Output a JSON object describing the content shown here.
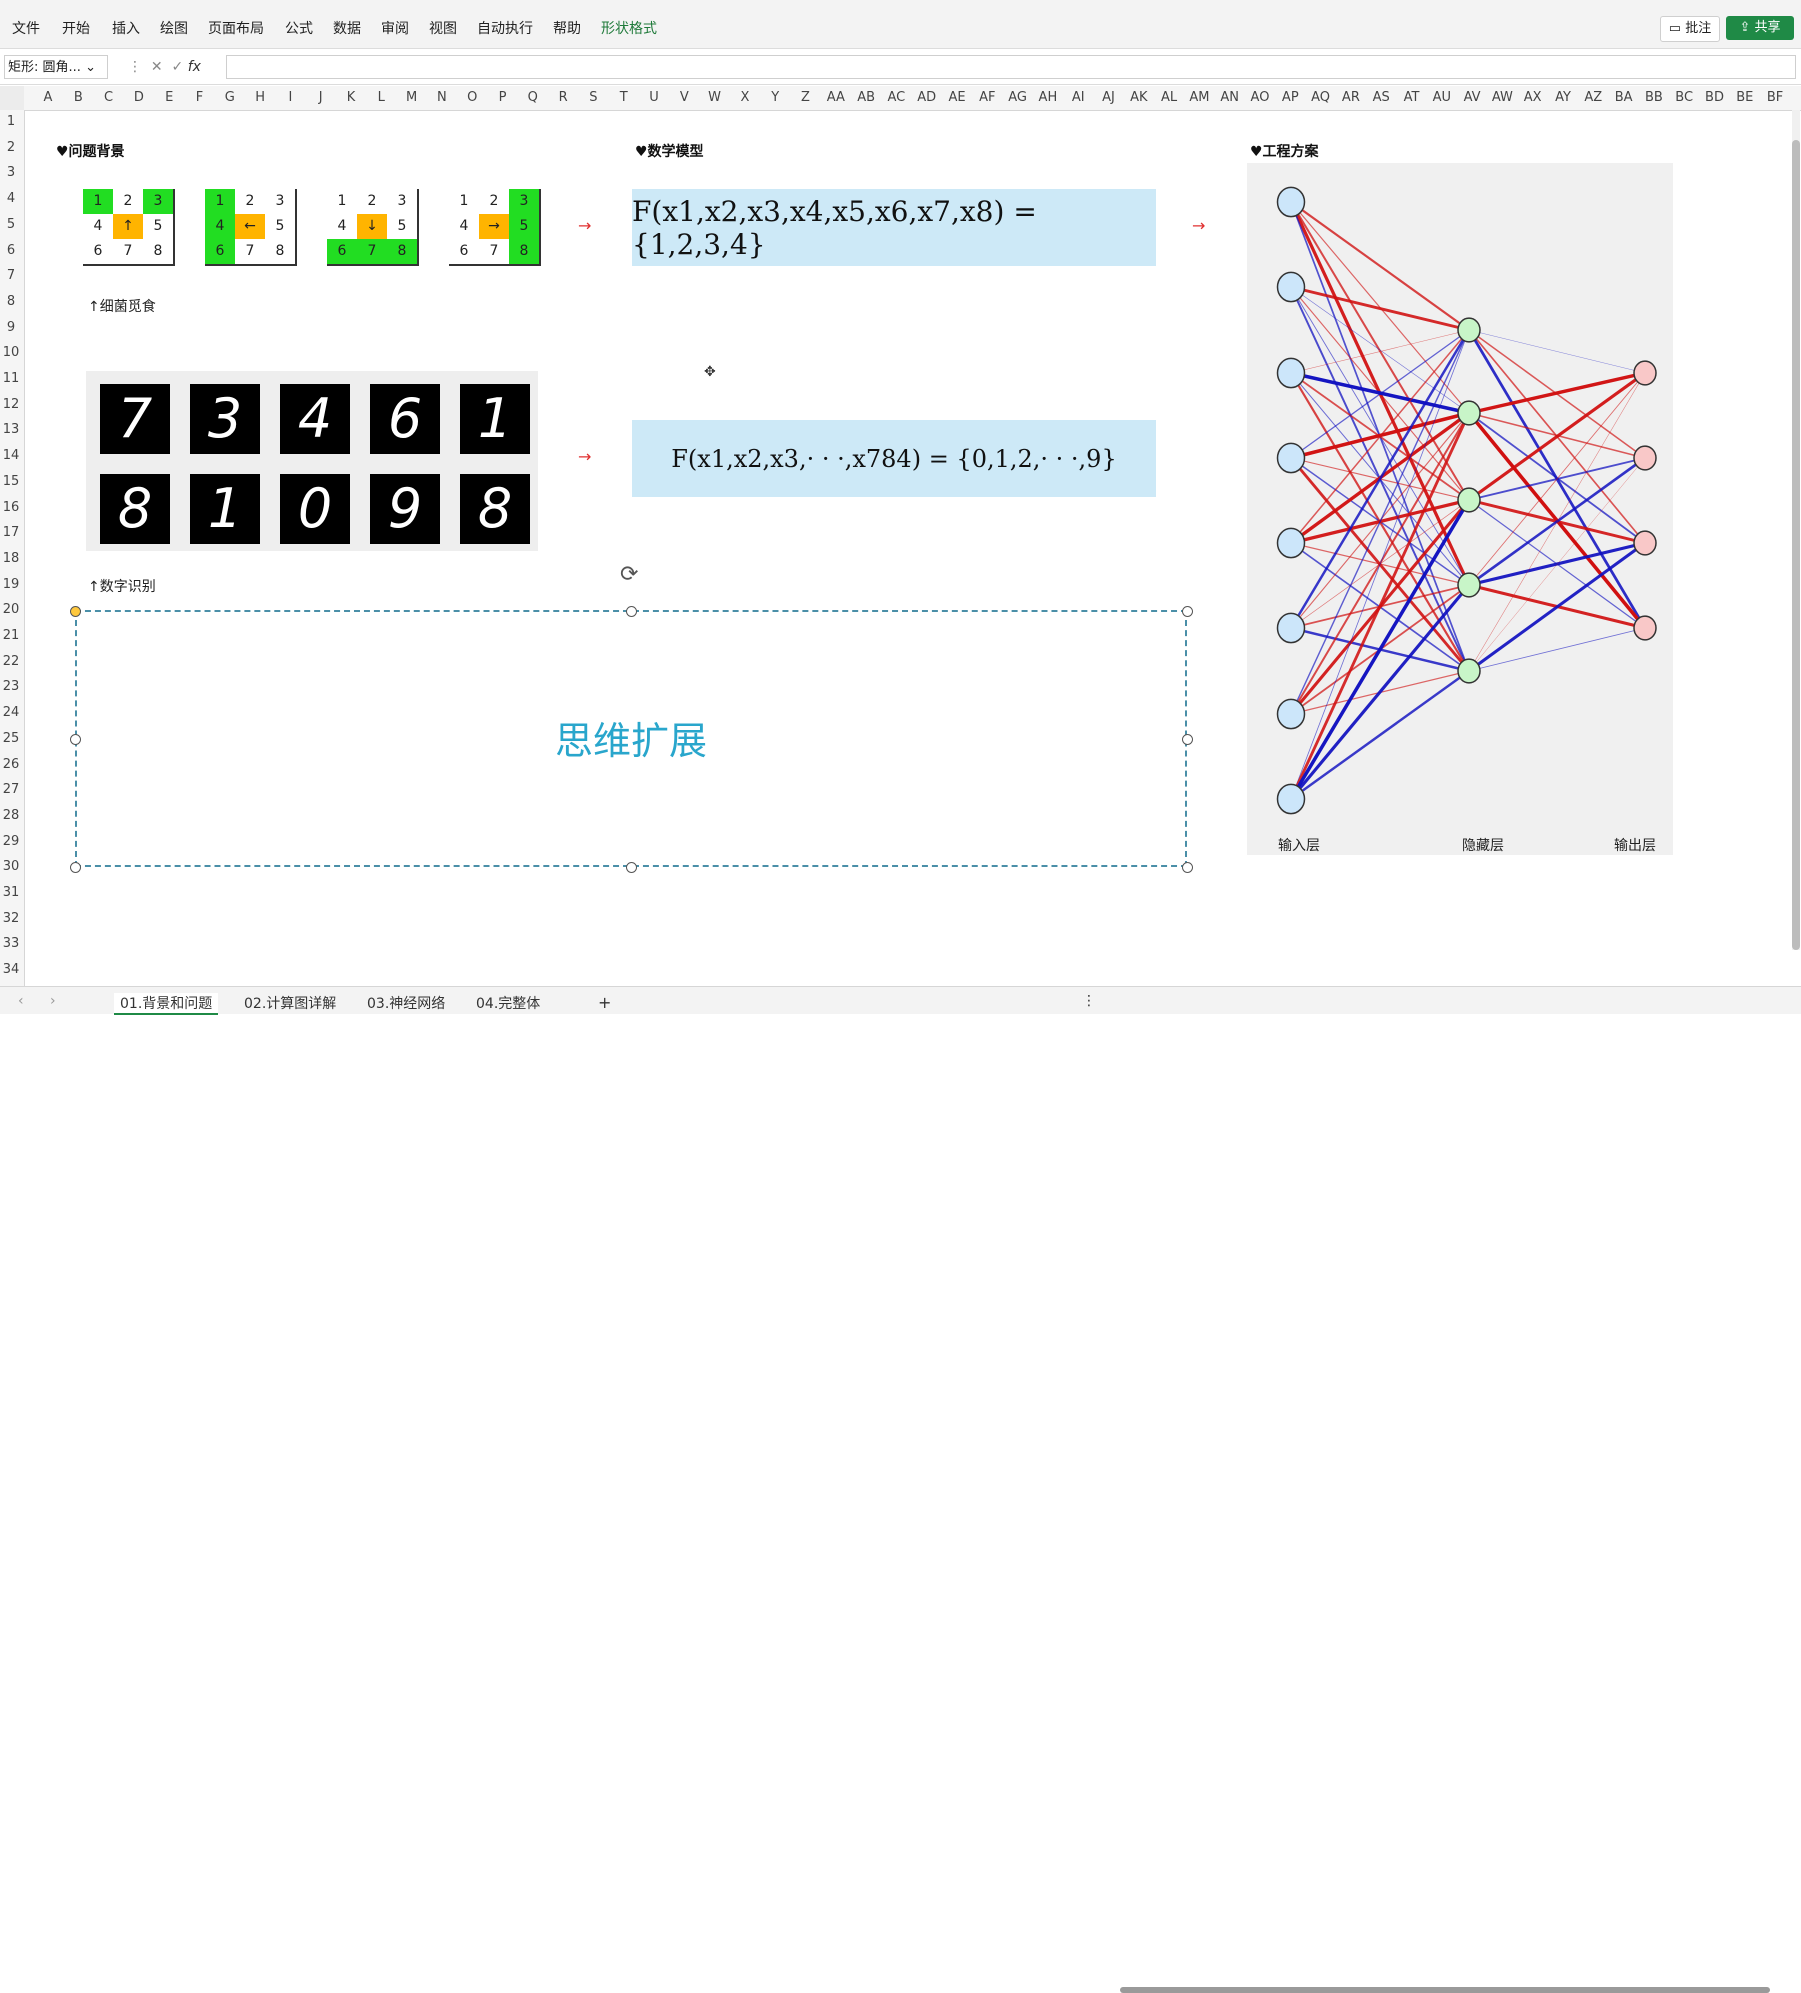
{
  "menu": {
    "items": [
      "文件",
      "开始",
      "插入",
      "绘图",
      "页面布局",
      "公式",
      "数据",
      "审阅",
      "视图",
      "自动执行",
      "帮助",
      "形状格式"
    ],
    "active": "形状格式",
    "comment_label": "批注",
    "share_label": "共享"
  },
  "formula_bar": {
    "name_box": "矩形: 圆角...",
    "fx_label": "fx",
    "value": ""
  },
  "columns": [
    "A",
    "B",
    "C",
    "D",
    "E",
    "F",
    "G",
    "H",
    "I",
    "J",
    "K",
    "L",
    "M",
    "N",
    "O",
    "P",
    "Q",
    "R",
    "S",
    "T",
    "U",
    "V",
    "W",
    "X",
    "Y",
    "Z",
    "AA",
    "AB",
    "AC",
    "AD",
    "AE",
    "AF",
    "AG",
    "AH",
    "AI",
    "AJ",
    "AK",
    "AL",
    "AM",
    "AN",
    "AO",
    "AP",
    "AQ",
    "AR",
    "AS",
    "AT",
    "AU",
    "AV",
    "AW",
    "AX",
    "AY",
    "AZ",
    "BA",
    "BB",
    "BC",
    "BD",
    "BE",
    "BF"
  ],
  "rows": [
    "1",
    "2",
    "3",
    "4",
    "5",
    "6",
    "7",
    "8",
    "9",
    "10",
    "11",
    "12",
    "13",
    "14",
    "15",
    "16",
    "17",
    "18",
    "19",
    "20",
    "21",
    "22",
    "23",
    "24",
    "25",
    "26",
    "27",
    "28",
    "29",
    "30",
    "31",
    "32",
    "33",
    "34"
  ],
  "sections": {
    "background": "♥问题背景",
    "model": "♥数学模型",
    "engineering": "♥工程方案"
  },
  "grids": [
    [
      [
        "1",
        "g"
      ],
      [
        "2",
        ""
      ],
      [
        "3",
        "g"
      ],
      [
        "4",
        ""
      ],
      [
        "↑",
        "o"
      ],
      [
        "5",
        ""
      ],
      [
        "6",
        ""
      ],
      [
        "7",
        ""
      ],
      [
        "8",
        ""
      ]
    ],
    [
      [
        "1",
        "g"
      ],
      [
        "2",
        ""
      ],
      [
        "3",
        ""
      ],
      [
        "4",
        "g"
      ],
      [
        "←",
        "o"
      ],
      [
        "5",
        ""
      ],
      [
        "6",
        "g"
      ],
      [
        "7",
        ""
      ],
      [
        "8",
        ""
      ]
    ],
    [
      [
        "1",
        ""
      ],
      [
        "2",
        ""
      ],
      [
        "3",
        ""
      ],
      [
        "4",
        ""
      ],
      [
        "↓",
        "o"
      ],
      [
        "5",
        ""
      ],
      [
        "6",
        "g"
      ],
      [
        "7",
        "g"
      ],
      [
        "8",
        "g"
      ]
    ],
    [
      [
        "1",
        ""
      ],
      [
        "2",
        ""
      ],
      [
        "3",
        "g"
      ],
      [
        "4",
        ""
      ],
      [
        "→",
        "o"
      ],
      [
        "5",
        "g"
      ],
      [
        "6",
        ""
      ],
      [
        "7",
        ""
      ],
      [
        "8",
        "g"
      ]
    ]
  ],
  "captions": {
    "bacteria": "↑细菌觅食",
    "digits": "↑数字识别"
  },
  "digits": [
    "7",
    "3",
    "4",
    "6",
    "1",
    "8",
    "1",
    "0",
    "9",
    "8"
  ],
  "arrow": "→",
  "formulas": {
    "f1": "F(x1,x2,x3,x4,x5,x6,x7,x8) = {1,2,3,4}",
    "f2": "F(x1,x2,x3,· · ·,x784) = {0,1,2,· · ·,9}"
  },
  "mind_map": "思维扩展",
  "nn_labels": {
    "input": "输入层",
    "hidden": "隐藏层",
    "output": "输出层"
  },
  "sheet_tabs": [
    "01.背景和问题",
    "02.计算图详解",
    "03.神经网络",
    "04.完整体"
  ],
  "colors": {
    "input_node": "#cce6fa",
    "hidden_node": "#c8f5c8",
    "output_node": "#f9c8c8",
    "edge_red": "#d01010",
    "edge_blue": "#1010c0"
  }
}
